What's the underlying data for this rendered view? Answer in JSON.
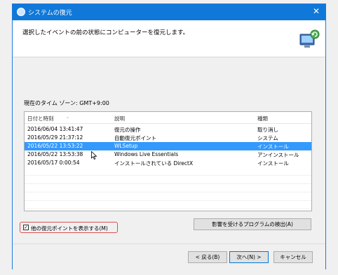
{
  "window": {
    "title": "システムの復元",
    "close_glyph": "✕"
  },
  "header": {
    "description": "選択したイベントの前の状態にコンピューターを復元します。"
  },
  "timezone": "現在のタイム ゾーン: GMT+9:00",
  "table": {
    "columns": [
      "日付と時刻",
      "説明",
      "種類"
    ],
    "selected_index": 2,
    "rows": [
      [
        "2016/06/04 13:41:47",
        "復元の操作",
        "取り消し"
      ],
      [
        "2016/05/29 21:37:12",
        "自動復元ポイント",
        "システム"
      ],
      [
        "2016/05/22 13:53:22",
        "WLSetup",
        "インストール"
      ],
      [
        "2016/05/22 13:53:38",
        "Windows Live Essentials",
        "アンインストール"
      ],
      [
        "2016/05/17 0:00:54",
        "インストールされている DirectX",
        "インストール"
      ]
    ]
  },
  "show_more_checkbox": {
    "label": "他の復元ポイントを表示する(M)",
    "checked": true
  },
  "buttons": {
    "scan": "影響を受けるプログラムの検出(A)",
    "back": "< 戻る(B)",
    "next": "次へ(N) >",
    "cancel": "キャンセル"
  },
  "colors": {
    "titlebar": "#1078d8",
    "selection": "#3399ff",
    "checkbox_highlight": "#d9534f"
  }
}
